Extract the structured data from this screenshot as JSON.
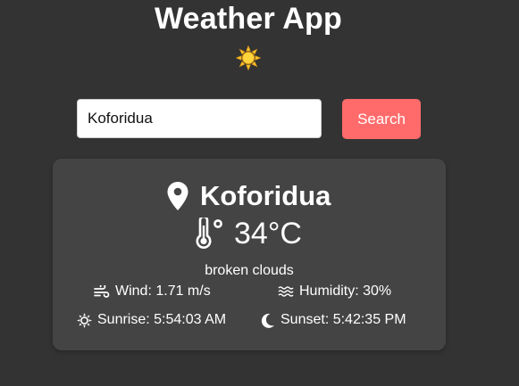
{
  "app": {
    "title": "Weather App",
    "logo_icon": "sun-icon"
  },
  "search": {
    "value": "Koforidua",
    "placeholder": "",
    "button_label": "Search"
  },
  "weather": {
    "city": "Koforidua",
    "temperature": "34°C",
    "description": "broken clouds",
    "wind": "Wind: 1.71 m/s",
    "humidity": "Humidity: 30%",
    "sunrise": "Sunrise: 5:54:03 AM",
    "sunset": "Sunset: 5:42:35 PM"
  },
  "icons": {
    "location": "map-pin-icon",
    "temperature": "thermometer-icon",
    "wind": "wind-icon",
    "humidity": "water-waves-icon",
    "sunrise": "sun-icon",
    "sunset": "moon-icon"
  },
  "colors": {
    "background": "#333333",
    "card": "#444444",
    "accent_button": "#ff6b6b",
    "sun": "#ffd43b",
    "text": "#ffffff"
  }
}
